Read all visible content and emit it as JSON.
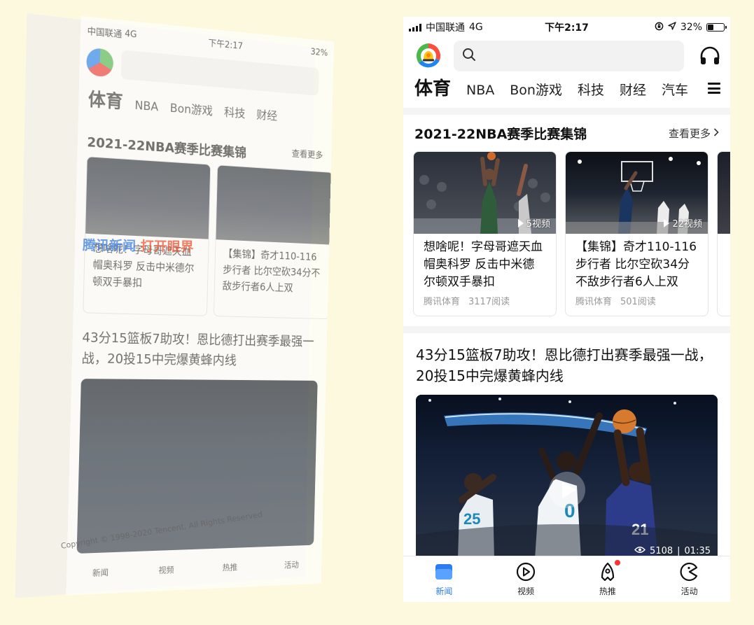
{
  "status": {
    "carrier": "中国联通",
    "network": "4G",
    "time": "下午2:17",
    "battery": "32%"
  },
  "header": {
    "logo_icon": "tencent-news-logo",
    "search_icon": "search-icon",
    "audio_icon": "headphones-icon"
  },
  "tabs": {
    "active": "体育",
    "items": [
      "NBA",
      "Bon游戏",
      "科技",
      "财经",
      "汽车"
    ],
    "menu_icon": "hamburger-menu-icon"
  },
  "section": {
    "title": "2021-22NBA赛季比赛集锦",
    "more": "查看更多"
  },
  "cards": [
    {
      "title": "想啥呢！字母哥遮天血帽奥科罗 反击中米德尔顿双手暴扣",
      "video_count": "5视频",
      "source": "腾讯体育",
      "reads": "3117阅读"
    },
    {
      "title": "【集锦】奇才110-116步行者 比尔空砍34分不敌步行者6人上双",
      "video_count": "22视频",
      "source": "腾讯体育",
      "reads": "501阅读"
    }
  ],
  "article": {
    "headline": "43分15篮板7助攻！恩比德打出赛季最强一战，20投15中完爆黄蜂内线",
    "views": "5108",
    "duration": "01:35"
  },
  "tabbar": {
    "items": [
      {
        "label": "新闻",
        "icon": "news-icon",
        "active": true
      },
      {
        "label": "视频",
        "icon": "video-play-icon"
      },
      {
        "label": "热推",
        "icon": "hot-rocket-icon",
        "badge": true
      },
      {
        "label": "活动",
        "icon": "pacman-activity-icon"
      }
    ]
  },
  "ghost": {
    "watermark_a": "腾讯新闻",
    "watermark_b": "打开眼界",
    "copyright": "Copyright © 1998-2020 Tencent. All Rights Reserved"
  },
  "colors": {
    "background": "#fdf9df",
    "accent": "#2b7cf0",
    "badge": "#ff3333"
  }
}
